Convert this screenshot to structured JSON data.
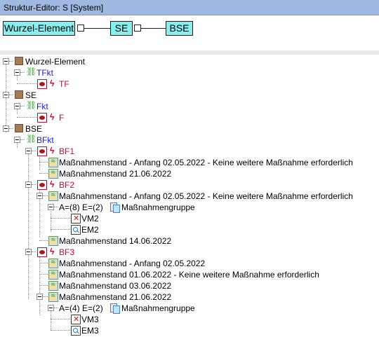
{
  "window": {
    "title": "Struktur-Editor: S [System]"
  },
  "diagram": {
    "nodes": [
      {
        "label": "Wurzel-Element"
      },
      {
        "label": "SE"
      },
      {
        "label": "BSE"
      }
    ],
    "colors": {
      "node_fill": "#86f0f0",
      "node_border": "#202020"
    }
  },
  "tree": {
    "root_elements": [
      {
        "label": "Wurzel-Element",
        "function": {
          "label": "TFkt",
          "fault": {
            "label": "TF"
          }
        }
      },
      {
        "label": "SE",
        "function": {
          "label": "Fkt",
          "fault": {
            "label": "F"
          }
        }
      },
      {
        "label": "BSE",
        "function": {
          "label": "BFkt",
          "faults": [
            {
              "label": "BF1",
              "measures": [
                "Maßnahmenstand - Anfang 02.05.2022 - Keine weitere Maßnahme erforderlich",
                "Maßnahmenstand 21.06.2022"
              ]
            },
            {
              "label": "BF2",
              "measures": [
                "Maßnahmenstand - Anfang 02.05.2022 - Keine weitere Maßnahme erforderlich",
                "Maßnahmenstand 14.06.2022"
              ],
              "group": {
                "prefix": "A=(8) E=(2)",
                "label": "Maßnahmengruppe",
                "children": [
                  "VM2",
                  "EM2"
                ]
              }
            },
            {
              "label": "BF3",
              "measures": [
                "Maßnahmenstand - Anfang 02.05.2022",
                "Maßnahmenstand 01.06.2022 - Keine weitere Maßnahme erforderlich",
                "Maßnahmenstand 03.06.2022",
                "Maßnahmenstand 21.06.2022"
              ],
              "group": {
                "prefix": "A=(4) E=(2)",
                "label": "Maßnahmengruppe",
                "children": [
                  "VM3",
                  "EM3"
                ]
              }
            }
          ]
        }
      }
    ],
    "colors": {
      "function_text": "#1a1adc",
      "fault_text": "#d2003a",
      "element_icon": "#a67c52"
    }
  }
}
